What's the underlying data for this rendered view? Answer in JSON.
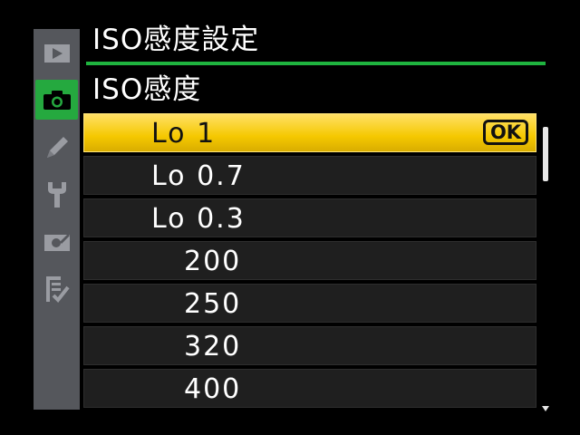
{
  "sidebar": {
    "tabs": [
      {
        "icon": "playback-icon",
        "active": false
      },
      {
        "icon": "camera-icon",
        "active": true
      },
      {
        "icon": "pencil-icon",
        "active": false
      },
      {
        "icon": "wrench-icon",
        "active": false
      },
      {
        "icon": "retouch-icon",
        "active": false
      },
      {
        "icon": "my-menu-icon",
        "active": false
      }
    ]
  },
  "header": {
    "title": "ISO感度設定",
    "section": "ISO感度"
  },
  "list": {
    "items": [
      {
        "label": "Lo 1",
        "selected": true
      },
      {
        "label": "Lo 0.7",
        "selected": false
      },
      {
        "label": "Lo 0.3",
        "selected": false
      },
      {
        "label": "200",
        "selected": false
      },
      {
        "label": "250",
        "selected": false
      },
      {
        "label": "320",
        "selected": false
      },
      {
        "label": "400",
        "selected": false
      }
    ],
    "ok_label": "OK"
  },
  "colors": {
    "accent": "#25a93f",
    "highlight": "#f5c800",
    "sidebar": "#55575c",
    "row": "#1f1f1f"
  },
  "scroll": {
    "position_fraction": 0.0,
    "visible_fraction": 0.2
  }
}
